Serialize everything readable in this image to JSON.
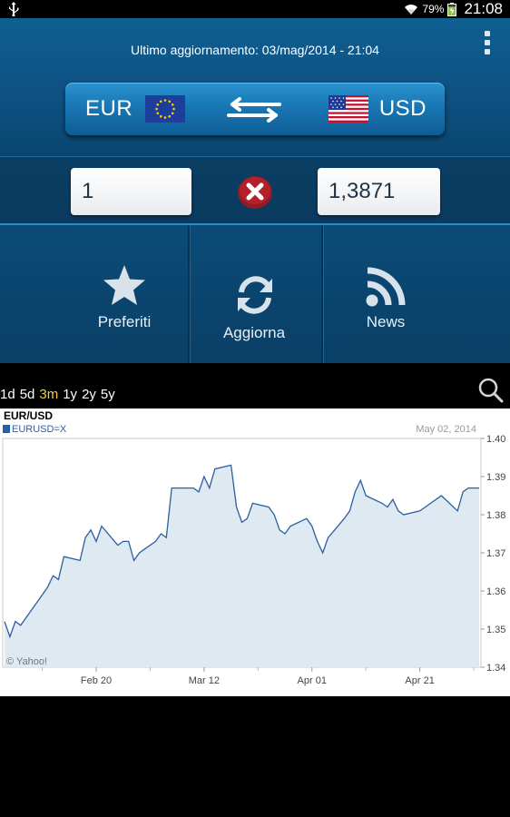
{
  "status_bar": {
    "battery": "79%",
    "time": "21:08"
  },
  "header": {
    "last_update": "Ultimo aggiornamento: 03/mag/2014 - 21:04"
  },
  "currency": {
    "from": "EUR",
    "to": "USD"
  },
  "converter": {
    "from_amount": "1",
    "to_amount": "1,3871"
  },
  "actions": {
    "favorites": "Preferiti",
    "refresh": "Aggiorna",
    "news": "News"
  },
  "ranges": [
    {
      "label": "1d",
      "active": false
    },
    {
      "label": "5d",
      "active": false
    },
    {
      "label": "3m",
      "active": true
    },
    {
      "label": "1y",
      "active": false
    },
    {
      "label": "2y",
      "active": false
    },
    {
      "label": "5y",
      "active": false
    }
  ],
  "icons": [
    "usb-icon",
    "wifi-icon",
    "battery-icon",
    "menu-icon",
    "eu-flag-icon",
    "swap-icon",
    "us-flag-icon",
    "clear-icon",
    "star-icon",
    "refresh-icon",
    "rss-icon",
    "search-icon"
  ],
  "colors": {
    "range_active": "#f4cb3d",
    "panel": "#0b4b77",
    "line": "#2b5fa0",
    "area": "#dfe9f2"
  },
  "chart_data": {
    "type": "area",
    "title": "EUR/USD",
    "series": [
      {
        "name": "EURUSD=X",
        "x": [
          "2014-02-03",
          "2014-02-04",
          "2014-02-05",
          "2014-02-06",
          "2014-02-07",
          "2014-02-10",
          "2014-02-11",
          "2014-02-12",
          "2014-02-13",
          "2014-02-14",
          "2014-02-17",
          "2014-02-18",
          "2014-02-19",
          "2014-02-20",
          "2014-02-21",
          "2014-02-24",
          "2014-02-25",
          "2014-02-26",
          "2014-02-27",
          "2014-02-28",
          "2014-03-03",
          "2014-03-04",
          "2014-03-05",
          "2014-03-06",
          "2014-03-07",
          "2014-03-10",
          "2014-03-11",
          "2014-03-12",
          "2014-03-13",
          "2014-03-14",
          "2014-03-17",
          "2014-03-18",
          "2014-03-19",
          "2014-03-20",
          "2014-03-21",
          "2014-03-24",
          "2014-03-25",
          "2014-03-26",
          "2014-03-27",
          "2014-03-28",
          "2014-03-31",
          "2014-04-01",
          "2014-04-02",
          "2014-04-03",
          "2014-04-04",
          "2014-04-07",
          "2014-04-08",
          "2014-04-09",
          "2014-04-10",
          "2014-04-11",
          "2014-04-14",
          "2014-04-15",
          "2014-04-16",
          "2014-04-17",
          "2014-04-18",
          "2014-04-21",
          "2014-04-22",
          "2014-04-23",
          "2014-04-24",
          "2014-04-25",
          "2014-04-28",
          "2014-04-29",
          "2014-04-30",
          "2014-05-01",
          "2014-05-02"
        ],
        "values": [
          1.352,
          1.348,
          1.352,
          1.351,
          1.353,
          1.359,
          1.361,
          1.364,
          1.363,
          1.369,
          1.368,
          1.374,
          1.376,
          1.373,
          1.377,
          1.372,
          1.373,
          1.373,
          1.368,
          1.37,
          1.373,
          1.375,
          1.374,
          1.387,
          1.387,
          1.387,
          1.386,
          1.39,
          1.387,
          1.392,
          1.393,
          1.382,
          1.378,
          1.379,
          1.383,
          1.382,
          1.38,
          1.376,
          1.375,
          1.377,
          1.379,
          1.377,
          1.373,
          1.37,
          1.374,
          1.379,
          1.381,
          1.386,
          1.389,
          1.385,
          1.383,
          1.382,
          1.384,
          1.381,
          1.38,
          1.381,
          1.382,
          1.383,
          1.384,
          1.385,
          1.381,
          1.386,
          1.387,
          1.387,
          1.387
        ]
      }
    ],
    "y_ticks": [
      "1.40",
      "1.39",
      "1.38",
      "1.37",
      "1.36",
      "1.35",
      "1.34"
    ],
    "x_ticks": [
      {
        "label": "Feb 20",
        "date": "2014-02-20"
      },
      {
        "label": "Mar 12",
        "date": "2014-03-12"
      },
      {
        "label": "Apr 01",
        "date": "2014-04-01"
      },
      {
        "label": "Apr 21",
        "date": "2014-04-21"
      }
    ],
    "ylim": [
      1.34,
      1.4
    ],
    "date_label": "May 02, 2014",
    "legend": "EURUSD=X",
    "legend_position": "top-left",
    "credit": "© Yahoo!",
    "grid": false
  }
}
